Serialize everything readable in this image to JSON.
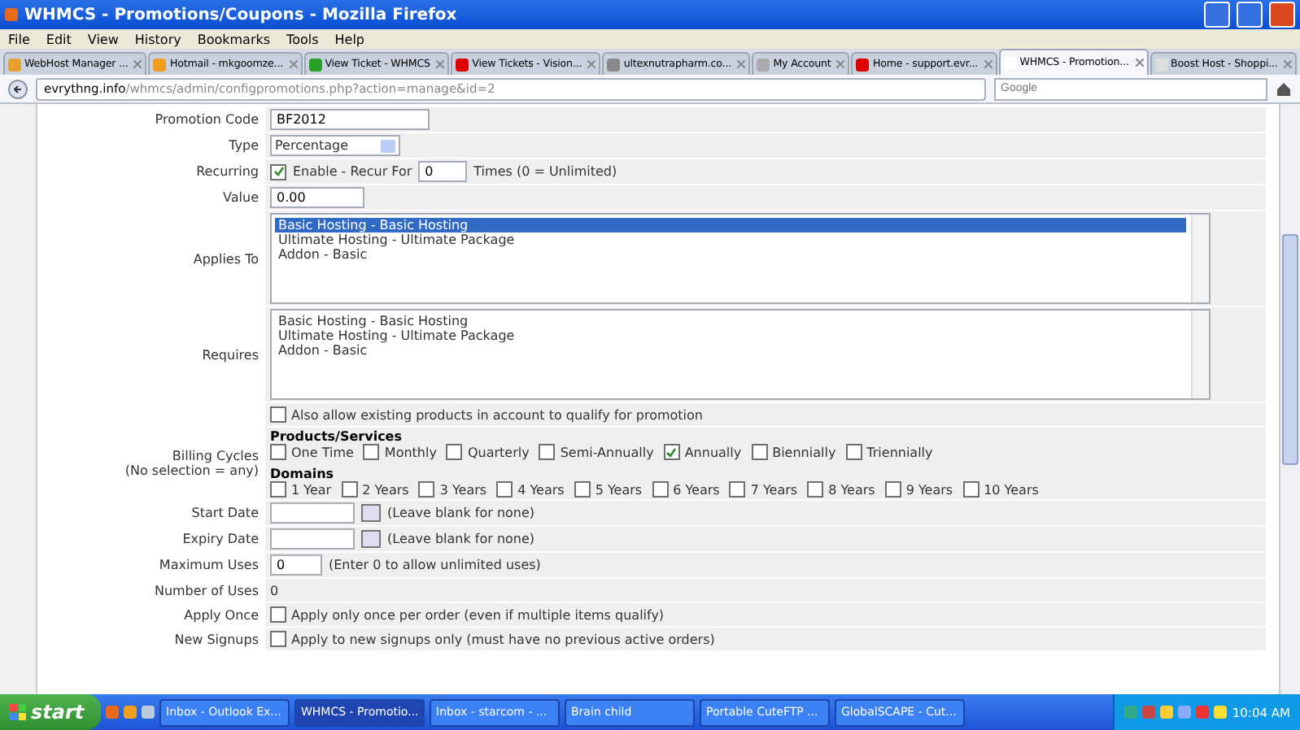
{
  "window": {
    "title": "WHMCS - Promotions/Coupons - Mozilla Firefox"
  },
  "menu": [
    "File",
    "Edit",
    "View",
    "History",
    "Bookmarks",
    "Tools",
    "Help"
  ],
  "tabs": [
    {
      "label": "WebHost Manager ...",
      "selected": false
    },
    {
      "label": "Hotmail - mkgoomze...",
      "selected": false
    },
    {
      "label": "View Ticket - WHMCS",
      "selected": false
    },
    {
      "label": "View Tickets - Vision...",
      "selected": false
    },
    {
      "label": "ultexnutrapharm.co...",
      "selected": false
    },
    {
      "label": "My Account",
      "selected": false
    },
    {
      "label": "Home - support.evr...",
      "selected": false
    },
    {
      "label": "WHMCS - Promotion...",
      "selected": true
    },
    {
      "label": "Boost Host - Shoppi...",
      "selected": false
    }
  ],
  "address_bar": {
    "domain": "evrythng.info",
    "path": "/whmcs/admin/configpromotions.php?action=manage&id=2"
  },
  "search": {
    "placeholder": "Google"
  },
  "form": [
    {
      "kind": "text",
      "label": "Promotion Code",
      "value": "BF2012"
    },
    {
      "kind": "select",
      "label": "Type",
      "value": "Percentage"
    },
    {
      "kind": "recurring",
      "label": "Recurring",
      "checked": true,
      "text": "Enable - Recur For",
      "value": "0",
      "note": "Times (0 = Unlimited)"
    },
    {
      "kind": "text",
      "label": "Value",
      "value": "0.00"
    },
    {
      "kind": "listbox",
      "label": "Applies To",
      "options": [
        {
          "text": "Basic Hosting - Basic Hosting",
          "selected": true
        },
        {
          "text": "Ultimate Hosting - Ultimate Package",
          "selected": false
        },
        {
          "text": "Addon - Basic",
          "selected": false
        }
      ]
    },
    {
      "kind": "listbox",
      "label": "Requires",
      "options": [
        {
          "text": "Basic Hosting - Basic Hosting",
          "selected": false
        },
        {
          "text": "Ultimate Hosting - Ultimate Package",
          "selected": false
        },
        {
          "text": "Addon - Basic",
          "selected": false
        }
      ]
    },
    {
      "kind": "checkbox",
      "checked": false,
      "text": "Also allow existing products in account to qualify for promotion"
    },
    {
      "kind": "billing",
      "label": "Billing Cycles",
      "sublabel": "(No selection = any)",
      "groups": [
        {
          "heading": "Products/Services",
          "options": [
            {
              "label": "One Time",
              "checked": false
            },
            {
              "label": "Monthly",
              "checked": false
            },
            {
              "label": "Quarterly",
              "checked": false
            },
            {
              "label": "Semi-Annually",
              "checked": false
            },
            {
              "label": "Annually",
              "checked": true
            },
            {
              "label": "Biennially",
              "checked": false
            },
            {
              "label": "Triennially",
              "checked": false
            }
          ]
        },
        {
          "heading": "Domains",
          "options": [
            {
              "label": "1 Year",
              "checked": false
            },
            {
              "label": "2 Years",
              "checked": false
            },
            {
              "label": "3 Years",
              "checked": false
            },
            {
              "label": "4 Years",
              "checked": false
            },
            {
              "label": "5 Years",
              "checked": false
            },
            {
              "label": "6 Years",
              "checked": false
            },
            {
              "label": "7 Years",
              "checked": false
            },
            {
              "label": "8 Years",
              "checked": false
            },
            {
              "label": "9 Years",
              "checked": false
            },
            {
              "label": "10 Years",
              "checked": false
            }
          ]
        }
      ]
    },
    {
      "kind": "date",
      "label": "Start Date",
      "note": "(Leave blank for none)"
    },
    {
      "kind": "date",
      "label": "Expiry Date",
      "note": "(Leave blank for none)"
    },
    {
      "kind": "number",
      "label": "Maximum Uses",
      "value": "0",
      "note": "(Enter 0 to allow unlimited uses)"
    },
    {
      "kind": "plain",
      "label": "Number of Uses",
      "value": "0"
    },
    {
      "kind": "checkbox",
      "label": "Apply Once",
      "checked": false,
      "text": "Apply only once per order (even if multiple items qualify)"
    },
    {
      "kind": "checkbox",
      "label": "New Signups",
      "checked": false,
      "text": "Apply to new signups only (must have no previous active orders)"
    }
  ],
  "taskbar": {
    "start": "start",
    "items": [
      {
        "label": "Inbox - Outlook Ex...",
        "selected": false
      },
      {
        "label": "WHMCS - Promotio...",
        "selected": true
      },
      {
        "label": "Inbox - starcom - ...",
        "selected": false
      },
      {
        "label": "Brain child",
        "selected": false
      },
      {
        "label": "Portable CuteFTP ...",
        "selected": false
      },
      {
        "label": "GlobalSCAPE - Cut...",
        "selected": false
      }
    ],
    "clock": "10:04 AM"
  }
}
